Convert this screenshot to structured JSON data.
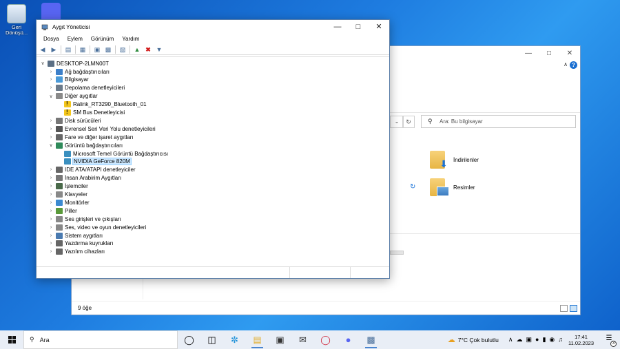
{
  "desktop": {
    "recycle_bin_label": "Geri Dönüşü...",
    "discord_label": ""
  },
  "explorer": {
    "search_placeholder": "Ara: Bu bilgisayar",
    "folders": [
      "İndirilenler",
      "Resimler"
    ],
    "status": "9 öğe"
  },
  "device_manager": {
    "title": "Aygıt Yöneticisi",
    "menu": [
      "Dosya",
      "Eylem",
      "Görünüm",
      "Yardım"
    ],
    "root": "DESKTOP-2LMN00T",
    "nodes": [
      {
        "label": "Ağ bağdaştırıcıları",
        "expanded": false,
        "color": "#3c7fc9"
      },
      {
        "label": "Bilgisayar",
        "expanded": false,
        "color": "#4a9ad8"
      },
      {
        "label": "Depolama denetleyicileri",
        "expanded": false,
        "color": "#6b7a8a"
      },
      {
        "label": "Diğer aygıtlar",
        "expanded": true,
        "color": "#8a8a8a"
      },
      {
        "label": "Ralink_RT3290_Bluetooth_01",
        "child": true,
        "warn": true
      },
      {
        "label": "SM Bus Denetleyicisi",
        "child": true,
        "warn": true
      },
      {
        "label": "Disk sürücüleri",
        "expanded": false,
        "color": "#777"
      },
      {
        "label": "Evrensel Seri Veri Yolu denetleyicileri",
        "expanded": false,
        "color": "#555"
      },
      {
        "label": "Fare ve diğer işaret aygıtları",
        "expanded": false,
        "color": "#666"
      },
      {
        "label": "Görüntü bağdaştırıcıları",
        "expanded": true,
        "color": "#2f8a5a"
      },
      {
        "label": "Microsoft Temel Görüntü Bağdaştırıcısı",
        "child": true,
        "color": "#3a8fbf"
      },
      {
        "label": "NVIDIA GeForce 820M",
        "child": true,
        "color": "#3a8fbf",
        "selected": true
      },
      {
        "label": "IDE ATA/ATAPI denetleyiciler",
        "expanded": false,
        "color": "#666"
      },
      {
        "label": "İnsan Arabirim Aygıtları",
        "expanded": false,
        "color": "#777"
      },
      {
        "label": "İşlemciler",
        "expanded": false,
        "color": "#4a6a4a"
      },
      {
        "label": "Klavyeler",
        "expanded": false,
        "color": "#888"
      },
      {
        "label": "Monitörler",
        "expanded": false,
        "color": "#3c8ad0"
      },
      {
        "label": "Piller",
        "expanded": false,
        "color": "#5a9a3a"
      },
      {
        "label": "Ses girişleri ve çıkışları",
        "expanded": false,
        "color": "#888"
      },
      {
        "label": "Ses, video ve oyun denetleyicileri",
        "expanded": false,
        "color": "#888"
      },
      {
        "label": "Sistem aygıtları",
        "expanded": false,
        "color": "#4a7ab0"
      },
      {
        "label": "Yazdırma kuyrukları",
        "expanded": false,
        "color": "#666"
      },
      {
        "label": "Yazılım cihazları",
        "expanded": false,
        "color": "#666"
      }
    ]
  },
  "taskbar": {
    "search_label": "Ara",
    "weather": "7°C  Çok bulutlu",
    "time": "17:41",
    "date": "11.02.2023",
    "notification_count": "3"
  }
}
